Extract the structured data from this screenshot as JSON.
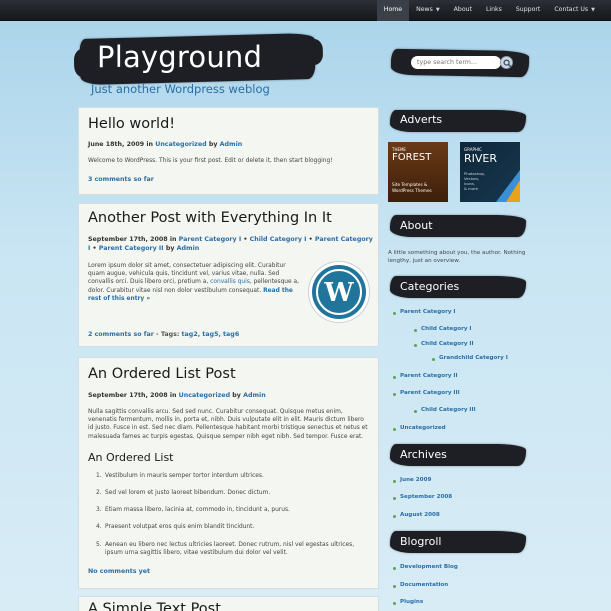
{
  "nav": {
    "items": [
      {
        "label": "Home",
        "active": true,
        "has_dropdown": false
      },
      {
        "label": "News",
        "active": false,
        "has_dropdown": true
      },
      {
        "label": "About",
        "active": false,
        "has_dropdown": false
      },
      {
        "label": "Links",
        "active": false,
        "has_dropdown": false
      },
      {
        "label": "Support",
        "active": false,
        "has_dropdown": false
      },
      {
        "label": "Contact Us",
        "active": false,
        "has_dropdown": true
      }
    ],
    "dropdown_icon": "chevron-down-icon"
  },
  "header": {
    "title": "Playground",
    "tagline": "Just another Wordpress weblog"
  },
  "search": {
    "placeholder": "type search term...",
    "button_icon": "search-icon"
  },
  "posts": [
    {
      "title": "Hello world!",
      "meta_date": "June 18th, 2009",
      "meta_in": "in",
      "category": "Uncategorized",
      "meta_by": "by",
      "author": "Admin",
      "body": "Welcome to WordPress. This is your first post. Edit or delete it, then start blogging!",
      "comments": "3 comments so far"
    },
    {
      "title": "Another Post with Everything In It",
      "meta_date": "September 17th, 2008",
      "meta_in": "in",
      "categories": [
        "Parent Category I",
        "Child Category I",
        "Parent Category I",
        "Parent Category II"
      ],
      "separator": "•",
      "meta_by": "by",
      "author": "Admin",
      "body": "Lorem ipsum dolor sit amet, consectetuer adipiscing elit. Curabitur quam augue, vehicula quis, tincidunt vel, varius vitae, nulla. Sed convallis orci. Duis libero orci, pretium a,",
      "body_link": "convallis quis",
      "body_tail": ", pellentesque a, dolor. Curabitur vitae nisl non dolor vestibulum consequat.",
      "read_more": "Read the rest of this entry »",
      "image_icon": "wordpress-logo-icon",
      "comments": "2 comments so far",
      "tags_label": "- Tags:",
      "tags": [
        "tag2",
        "tag5",
        "tag6"
      ]
    },
    {
      "title": "An Ordered List Post",
      "meta_date": "September 17th, 2008",
      "meta_in": "in",
      "category": "Uncategorized",
      "meta_by": "by",
      "author": "Admin",
      "body": "Nulla sagittis convallis arcu. Sed sed nunc. Curabitur consequat. Quisque metus enim, venenatis fermentum, mollis in, porta et, nibh. Duis vulputate elit in elit. Mauris dictum libero id justo. Fusce in est. Sed nec diam. Pellentesque habitant morbi tristique senectus et netus et malesuada fames ac turpis egestas. Quisque semper nibh eget nibh. Sed tempor. Fusce erat.",
      "sub_heading": "An Ordered List",
      "list": [
        "Vestibulum in mauris semper tortor interdum ultrices.",
        "Sed vel lorem et justo laoreet bibendum. Donec dictum.",
        "Etiam massa libero, lacinia at, commodo in, tincidunt a, purus.",
        "Praesent volutpat eros quis enim blandit tincidunt.",
        "Aenean eu libero nec lectus ultricies laoreet. Donec rutrum, nisl vel egestas ultrices, ipsum urna sagittis libero, vitae vestibulum dui dolor vel velit."
      ],
      "comments": "No comments yet"
    },
    {
      "title": "A Simple Text Post"
    }
  ],
  "sidebar": {
    "adverts_title": "Adverts",
    "ad_forest": {
      "line1": "THEME",
      "line2": "FOREST",
      "line3": "Site Templates &",
      "line4": "WordPress Themes"
    },
    "ad_river": {
      "line1": "GRAPHIC",
      "line2": "RIVER",
      "line3": "Photoshop,",
      "line4": "Vectors,",
      "line5": "Icons,",
      "line6": "& more"
    },
    "about_title": "About",
    "about_text": "A little something about you, the author. Nothing lengthy, just an overview.",
    "categories_title": "Categories",
    "categories": [
      {
        "label": "Parent Category I",
        "level": 0
      },
      {
        "label": "Child Category I",
        "level": 1
      },
      {
        "label": "Child Category II",
        "level": 1
      },
      {
        "label": "Grandchild Category I",
        "level": 2
      },
      {
        "label": "Parent Category II",
        "level": 0
      },
      {
        "label": "Parent Category III",
        "level": 0
      },
      {
        "label": "Child Category III",
        "level": 1
      },
      {
        "label": "Uncategorized",
        "level": 0
      }
    ],
    "archives_title": "Archives",
    "archives": [
      "June 2009",
      "September 2008",
      "August 2008"
    ],
    "blogroll_title": "Blogroll",
    "blogroll": [
      "Development Blog",
      "Documentation",
      "Plugins"
    ]
  },
  "colors": {
    "link": "#2a6ea5",
    "nav_bg": "#1e2026",
    "brush": "#1d1f24",
    "bullet": "#5aa653",
    "post_bg": "#f4f6f1"
  }
}
